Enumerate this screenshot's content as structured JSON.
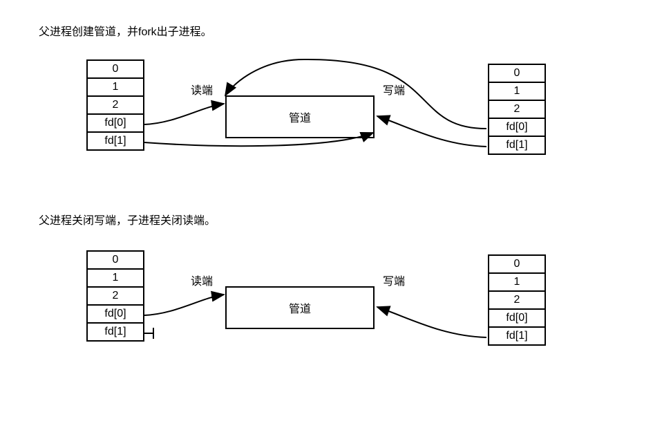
{
  "diagram1": {
    "caption": "父进程创建管道，并fork出子进程。",
    "left_table": [
      "0",
      "1",
      "2",
      "fd[0]",
      "fd[1]"
    ],
    "right_table": [
      "0",
      "1",
      "2",
      "fd[0]",
      "fd[1]"
    ],
    "pipe_label": "管道",
    "read_label": "读端",
    "write_label": "写端"
  },
  "diagram2": {
    "caption": "父进程关闭写端，子进程关闭读端。",
    "left_table": [
      "0",
      "1",
      "2",
      "fd[0]",
      "fd[1]"
    ],
    "right_table": [
      "0",
      "1",
      "2",
      "fd[0]",
      "fd[1]"
    ],
    "pipe_label": "管道",
    "read_label": "读端",
    "write_label": "写端"
  }
}
